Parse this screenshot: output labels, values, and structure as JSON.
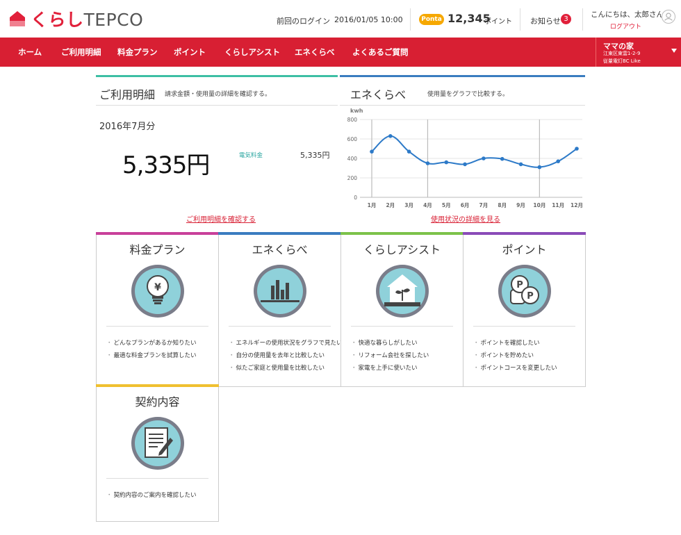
{
  "header": {
    "logo_kurashi": "くらし",
    "logo_tepco": "TEPCO",
    "last_login_label": "前回のログイン",
    "last_login_datetime": "2016/01/05  10:00",
    "ponta_label": "Ponta",
    "points_value": "12,345",
    "points_unit": "ポイント",
    "notice_label": "お知らせ",
    "notice_count": "3",
    "greeting": "こんにちは、太郎さん",
    "logout_label": "ログアウト",
    "icons": {
      "logo": "house-icon",
      "user": "user-icon"
    }
  },
  "nav": {
    "items": [
      "ホーム",
      "ご利用明細",
      "料金プラン",
      "ポイント",
      "くらしアシスト",
      "エネくらべ",
      "よくあるご質問"
    ],
    "home_name": "ママの家",
    "home_address": "江東区東雲1-2-9",
    "home_plan": "従量電灯BC Like",
    "bg_color": "#d81f33"
  },
  "billing_panel": {
    "title": "ご利用明細",
    "description": "請求金額・使用量の詳細を確認する。",
    "month": "2016年7月分",
    "amount": "5,335円",
    "item_label": "電気料金",
    "item_value": "5,335円",
    "link": "ご利用明細を確認する",
    "accent_color": "#3dbfa4"
  },
  "compare_panel": {
    "title": "エネくらべ",
    "description": "使用量をグラフで比較する。",
    "link": "使用状況の詳細を見る",
    "accent_color": "#3a7cc0"
  },
  "chart_data": {
    "type": "line",
    "ylabel": "kwh",
    "ylim": [
      0,
      800
    ],
    "yticks": [
      0,
      200,
      400,
      600,
      800
    ],
    "categories": [
      "1月",
      "2月",
      "3月",
      "4月",
      "5月",
      "6月",
      "7月",
      "8月",
      "9月",
      "10月",
      "11月",
      "12月"
    ],
    "series": [
      {
        "values": [
          470,
          630,
          470,
          350,
          360,
          340,
          400,
          395,
          340,
          310,
          370,
          500
        ]
      }
    ],
    "line_color": "#2d7ac8",
    "grid": true
  },
  "cards": [
    {
      "title": "料金プラン",
      "icon": "yen-bulb-icon",
      "accent": "#c8409a",
      "items": [
        "どんなプランがあるか知りたい",
        "最適な料金プランを試算したい"
      ]
    },
    {
      "title": "エネくらべ",
      "icon": "bar-chart-icon",
      "accent": "#3a7cc0",
      "items": [
        "エネルギーの使用状況をグラフで見たい",
        "自分の使用量を去年と比較したい",
        "似たご家庭と使用量を比較したい"
      ]
    },
    {
      "title": "くらしアシスト",
      "icon": "house-sprout-icon",
      "accent": "#7cc24a",
      "items": [
        "快適な暮らしがしたい",
        "リフォーム会社を探したい",
        "家電を上手に使いたい"
      ]
    },
    {
      "title": "ポイント",
      "icon": "point-coins-icon",
      "accent": "#8a4bb8",
      "items": [
        "ポイントを確認したい",
        "ポイントを貯めたい",
        "ポイントコースを変更したい"
      ]
    },
    {
      "title": "契約内容",
      "icon": "contract-document-icon",
      "accent": "#f0c030",
      "items": [
        "契約内容のご案内を確認したい"
      ]
    }
  ]
}
